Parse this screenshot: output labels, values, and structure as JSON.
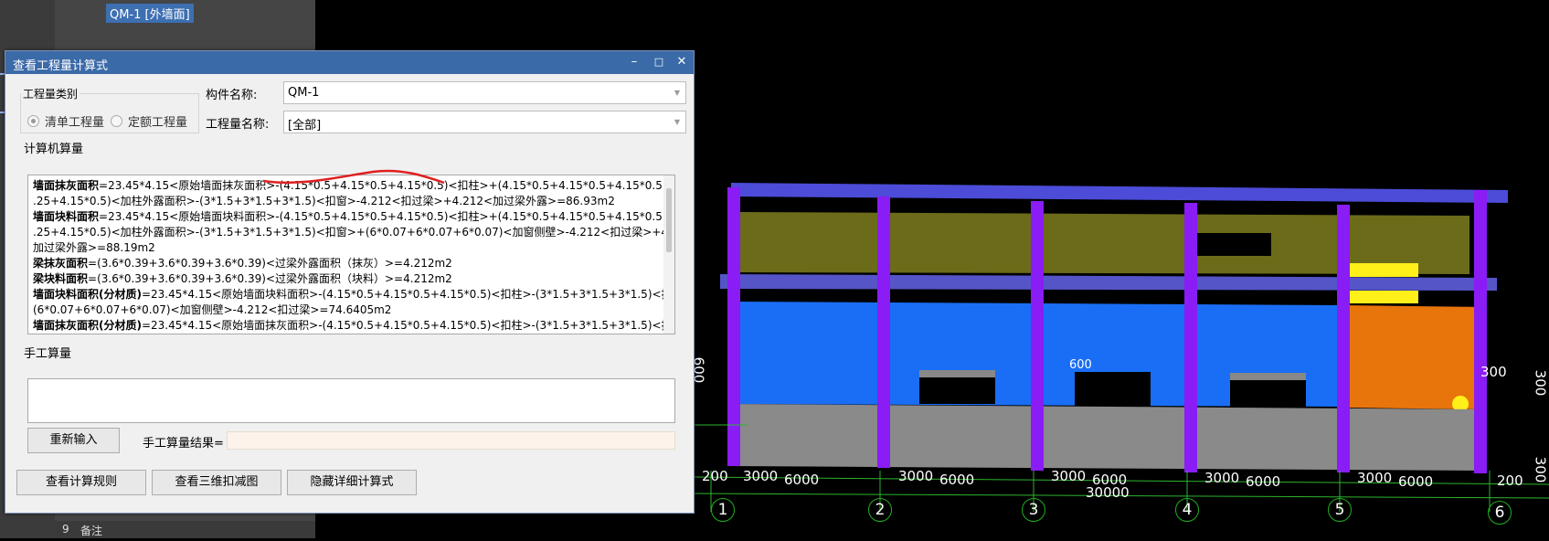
{
  "background": {
    "chip": "QM-1 [外墙面]",
    "row_number": "9",
    "row_text": "备注"
  },
  "dialog": {
    "title": "查看工程量计算式",
    "window_buttons": {
      "minimize": "–",
      "maximize": "□",
      "close": "✕"
    },
    "category_group": {
      "legend": "工程量类别",
      "options": [
        {
          "label": "清单工程量",
          "selected": true
        },
        {
          "label": "定额工程量",
          "selected": false
        }
      ]
    },
    "component_name_label": "构件名称:",
    "component_name_value": "QM-1",
    "quantity_name_label": "工程量名称:",
    "quantity_name_value": "[全部]",
    "computer_group_label": "计算机算量",
    "calc_lines": [
      {
        "bold": "墙面抹灰面积",
        "text": "=23.45*4.15<原始墙面抹灰面积>-(4.15*0.5+4.15*0.5+4.15*0.5)<扣柱>+(4.15*0.5+4.15*0.5+4.15*0.5+4.15*0"
      },
      {
        "bold": "",
        "text": ".25+4.15*0.5)<加柱外露面积>-(3*1.5+3*1.5+3*1.5)<扣窗>-4.212<扣过梁>+4.212<加过梁外露>=86.93m2"
      },
      {
        "bold": "墙面块料面积",
        "text": "=23.45*4.15<原始墙面块料面积>-(4.15*0.5+4.15*0.5+4.15*0.5)<扣柱>+(4.15*0.5+4.15*0.5+4.15*0.5+4.15*0"
      },
      {
        "bold": "",
        "text": ".25+4.15*0.5)<加柱外露面积>-(3*1.5+3*1.5+3*1.5)<扣窗>+(6*0.07+6*0.07+6*0.07)<加窗侧壁>-4.212<扣过梁>+4.212<"
      },
      {
        "bold": "",
        "text": "加过梁外露>=88.19m2"
      },
      {
        "bold": "梁抹灰面积",
        "text": "=(3.6*0.39+3.6*0.39+3.6*0.39)<过梁外露面积（抹灰）>=4.212m2"
      },
      {
        "bold": "梁块料面积",
        "text": "=(3.6*0.39+3.6*0.39+3.6*0.39)<过梁外露面积（块料）>=4.212m2"
      },
      {
        "bold": "墙面块料面积(分材质)",
        "text": "=23.45*4.15<原始墙面块料面积>-(4.15*0.5+4.15*0.5+4.15*0.5)<扣柱>-(3*1.5+3*1.5+3*1.5)<扣窗>+"
      },
      {
        "bold": "",
        "text": "(6*0.07+6*0.07+6*0.07)<加窗侧壁>-4.212<扣过梁>=74.6405m2"
      },
      {
        "bold": "墙面抹灰面积(分材质)",
        "text": "=23.45*4.15<原始墙面抹灰面积>-(4.15*0.5+4.15*0.5+4.15*0.5)<扣柱>-(3*1.5+3*1.5+3*1.5)<扣窗>-"
      }
    ],
    "manual_group_label": "手工算量",
    "reenter_button": "重新输入",
    "manual_result_label": "手工算量结果=",
    "manual_result_value": "",
    "view_rules_button": "查看计算规则",
    "view_3d_button": "查看三维扣减图",
    "hide_detail_button": "隐藏详细计算式"
  },
  "view3d": {
    "dim_labels": [
      "200",
      "3000",
      "6000",
      "3000",
      "6000",
      "3000",
      "6000",
      "3000",
      "6000",
      "3000",
      "6000",
      "200",
      "30000"
    ],
    "axis_numbers": [
      "1",
      "2",
      "3",
      "4",
      "5",
      "6"
    ],
    "side_labels": {
      "left": "600",
      "right1": "300",
      "right2": "300",
      "right3": "300"
    },
    "window_label": "600",
    "colors": {
      "wall_blue": "#1a6ef5",
      "column_purple": "#8a1cf5",
      "beam_blue": "#4c4cd8",
      "olive": "#6b6b1a",
      "base_gray": "#8a8a8a",
      "orange": "#e8740c",
      "yellow": "#fff01a"
    }
  }
}
